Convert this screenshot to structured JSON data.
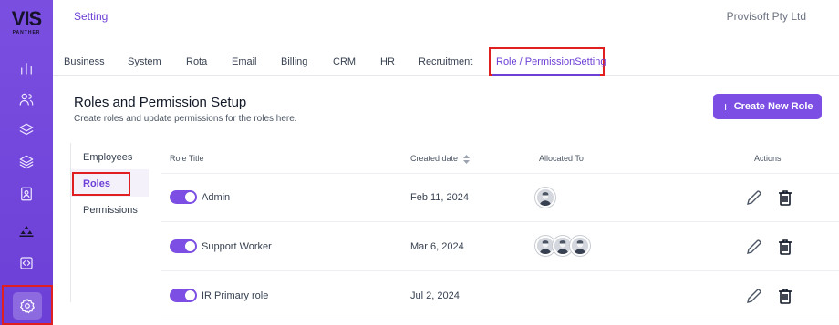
{
  "brand": {
    "logo_text": "VIS",
    "logo_sub": "PANTHER"
  },
  "header": {
    "title": "Setting",
    "company": "Provisoft Pty Ltd"
  },
  "tabs": [
    {
      "label": "Business"
    },
    {
      "label": "System"
    },
    {
      "label": "Rota"
    },
    {
      "label": "Email"
    },
    {
      "label": "Billing"
    },
    {
      "label": "CRM"
    },
    {
      "label": "HR"
    },
    {
      "label": "Recruitment"
    },
    {
      "label": "Role / PermissionSetting",
      "active": true
    }
  ],
  "section": {
    "title": "Roles and Permission Setup",
    "subtitle": "Create roles and update permissions for the roles here.",
    "create_button": "Create New Role"
  },
  "subnav": [
    {
      "label": "Employees"
    },
    {
      "label": "Roles",
      "active": true
    },
    {
      "label": "Permissions"
    }
  ],
  "table": {
    "headers": {
      "role_title": "Role Title",
      "created_date": "Created date",
      "allocated_to": "Allocated To",
      "actions": "Actions"
    },
    "rows": [
      {
        "enabled": true,
        "title": "Admin",
        "created": "Feb 11, 2024",
        "avatars": 1
      },
      {
        "enabled": true,
        "title": "Support Worker",
        "created": "Mar 6, 2024",
        "avatars": 3
      },
      {
        "enabled": true,
        "title": "IR Primary role",
        "created": "Jul 2, 2024",
        "avatars": 0
      }
    ]
  },
  "icons": {
    "sidebar": [
      "bar-chart-icon",
      "users-icon",
      "layers-icon",
      "stack-icon",
      "contact-book-icon",
      "hierarchy-icon",
      "code-icon",
      "settings-icon"
    ],
    "row_actions": [
      "edit-icon",
      "delete-icon"
    ],
    "sort": "sort-icon"
  },
  "colors": {
    "accent": "#7c4ee4",
    "sidebar": "#6c3fd6",
    "highlight_box": "#e02020"
  }
}
